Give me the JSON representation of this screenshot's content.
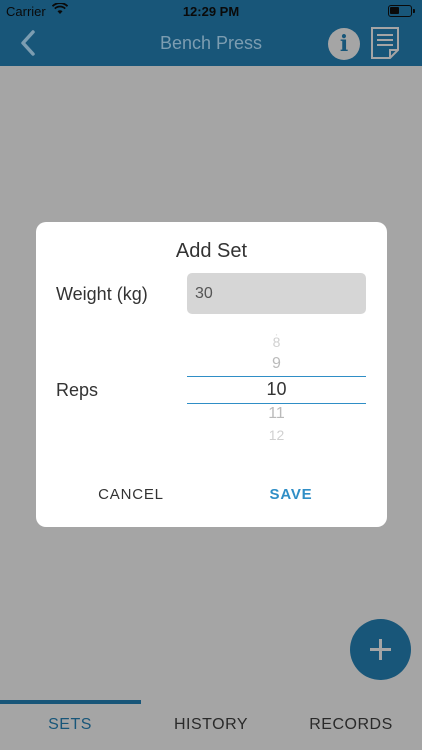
{
  "status_bar": {
    "carrier": "Carrier",
    "time": "12:29 PM"
  },
  "nav": {
    "title": "Bench Press",
    "back_icon": "chevron-left-icon",
    "info_icon": "info-icon",
    "notes_icon": "notes-icon"
  },
  "dialog": {
    "title": "Add Set",
    "weight_label": "Weight (kg)",
    "weight_value": "30",
    "reps_label": "Reps",
    "reps_options": [
      "8",
      "9",
      "10",
      "11",
      "12"
    ],
    "reps_selected": "10",
    "cancel_label": "CANCEL",
    "save_label": "SAVE"
  },
  "fab_icon": "plus-icon",
  "tabs": {
    "sets": "SETS",
    "history": "HISTORY",
    "records": "RECORDS",
    "active": "SETS"
  },
  "colors": {
    "primary": "#185679",
    "accent": "#2f8ec6",
    "overlay": "#a5a5a5"
  }
}
